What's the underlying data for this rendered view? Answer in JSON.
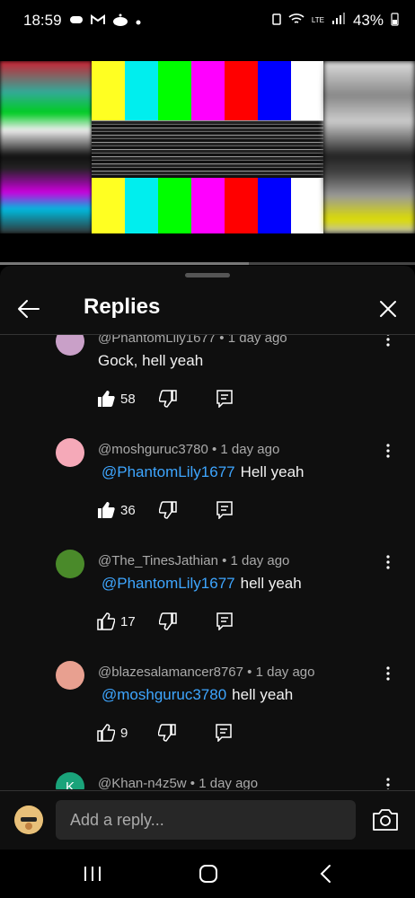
{
  "status_bar": {
    "time": "18:59",
    "battery": "43%",
    "network": "LTE",
    "left_icons": [
      "game-controller-icon",
      "gmail-icon",
      "reddit-icon",
      "dot-icon"
    ],
    "right_icons": [
      "battery-saver-icon",
      "wifi-icon",
      "volte-icon",
      "signal-icon",
      "battery-icon"
    ]
  },
  "video": {
    "progress": 0.6
  },
  "sheet": {
    "title": "Replies"
  },
  "replies": [
    {
      "author": "@PhantomLily1677",
      "time": "1 day ago",
      "mention": "",
      "text": "Gock, hell yeah",
      "likes": "58",
      "liked": true,
      "avatar_color": "#c9a0c8"
    },
    {
      "author": "@moshguruc3780",
      "time": "1 day ago",
      "mention": "@PhantomLily1677",
      "text": "Hell yeah",
      "likes": "36",
      "liked": true,
      "avatar_color": "#f5a9b8"
    },
    {
      "author": "@The_TinesJathian",
      "time": "1 day ago",
      "mention": "@PhantomLily1677",
      "text": "hell yeah",
      "likes": "17",
      "liked": false,
      "avatar_color": "#4a8a2a"
    },
    {
      "author": "@blazesalamancer8767",
      "time": "1 day ago",
      "mention": "@moshguruc3780",
      "text": "hell yeah",
      "likes": "9",
      "liked": false,
      "avatar_color": "#e8a090"
    },
    {
      "author": "@Khan-n4z5w",
      "time": "1 day ago",
      "mention": "",
      "text": "",
      "likes": "",
      "liked": false,
      "avatar_color": "#1aa37a",
      "avatar_letter": "K"
    }
  ],
  "composer": {
    "placeholder": "Add a reply..."
  },
  "colors": {
    "accent": "#3ea6ff",
    "sheet_bg": "#0f0f0f",
    "input_bg": "#272727"
  }
}
